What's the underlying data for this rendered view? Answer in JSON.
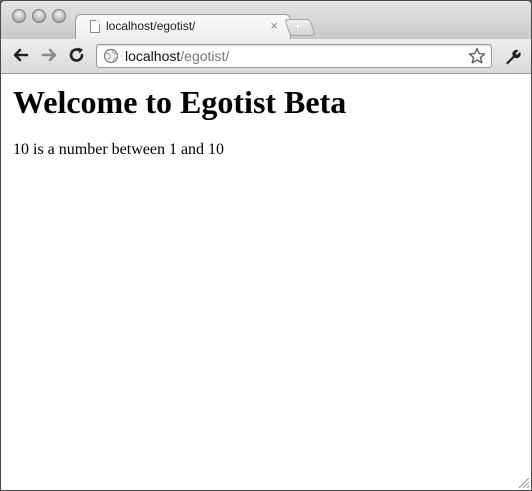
{
  "browser": {
    "tab": {
      "title": "localhost/egotist/",
      "close_glyph": "×",
      "icon": "document-icon"
    },
    "new_tab_glyph": "+",
    "omnibox": {
      "host": "localhost",
      "path": "/egotist/",
      "icon": "globe-icon"
    },
    "icons": [
      "back-arrow-icon",
      "forward-arrow-icon",
      "reload-icon",
      "star-icon",
      "wrench-icon"
    ]
  },
  "page": {
    "heading": "Welcome to Egotist Beta",
    "message": "10 is a number between 1 and 10"
  }
}
